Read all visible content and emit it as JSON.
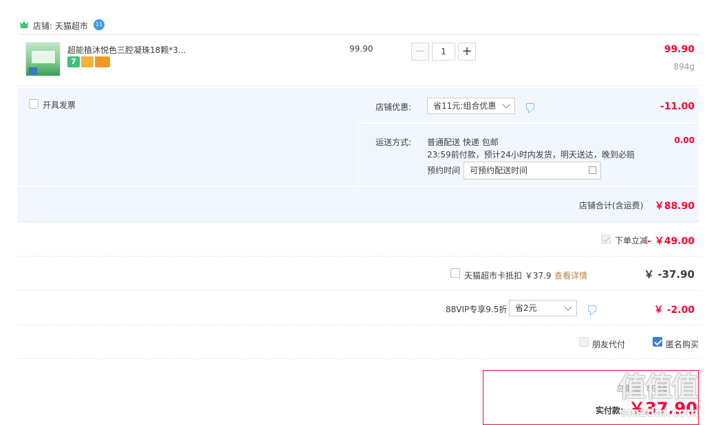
{
  "shop": {
    "label": "店铺: 天猫超市",
    "chat_badge": "11"
  },
  "item": {
    "title": "超能植沐悦色三腔凝珠18颗*3...",
    "unit_price": "99.90",
    "quantity": "1",
    "minus": "−",
    "plus": "+",
    "subtotal": "99.90",
    "weight": "894g",
    "badge_seven": "7"
  },
  "invoice": {
    "label": "开具发票"
  },
  "shop_discount": {
    "label": "店铺优惠:",
    "selected": "省11元:组合优惠",
    "amount": "-11.00"
  },
  "shipping": {
    "label": "运送方式:",
    "method": "普通配送 快递 包邮",
    "detail": "23:59前付款，预计24小时内发货，明天送达，晚到必赔",
    "schedule_label": "预约时间",
    "schedule_placeholder": "可预约配送时间",
    "amount": "0.00"
  },
  "shop_total": {
    "label": "店铺合计(含运费)",
    "amount": "￥88.90"
  },
  "instant_discount": {
    "label": "下单立减",
    "amount": "- ￥49.00"
  },
  "tmall_card": {
    "label": "天猫超市卡抵扣 ￥37.9",
    "link": "查看详情",
    "amount": "￥ -37.90"
  },
  "vip": {
    "label": "88VIP专享9.5折",
    "selected": "省2元",
    "amount": "￥ -2.00"
  },
  "options": {
    "friend_pay": "朋友代付",
    "anonymous": "匿名购买"
  },
  "summary": {
    "weight_label": "总重量: 894g",
    "pay_label": "实付款:",
    "pay_amount": "￥37.90"
  },
  "watermark": {
    "logo": "值值值",
    "site": "smzdm.com"
  }
}
